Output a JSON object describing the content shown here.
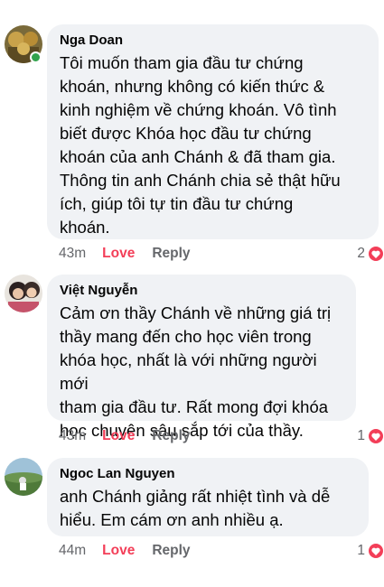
{
  "comments": [
    {
      "author": "Nga Doan",
      "online": true,
      "text": "Tôi muốn tham gia đầu tư chứng\nkhoán, nhưng không có kiến thức &\nkinh nghiệm về chứng khoán. Vô tình\nbiết được Khóa học đầu tư chứng\nkhoán của anh Chánh & đã tham gia.\nThông tin anh Chánh chia sẻ thật hữu\ních, giúp tôi tự tin đầu tư chứng\nkhoán.",
      "time": "43m",
      "love_label": "Love",
      "reply_label": "Reply",
      "reaction_count": "2",
      "reaction_icon": "heart-icon"
    },
    {
      "author": "Việt Nguyễn",
      "online": false,
      "text": "Cảm ơn thầy Chánh về những giá trị\nthầy mang đến cho học viên trong\nkhóa học, nhất là với những người mới\ntham gia đầu tư. Rất mong đợi khóa\nhọc chuyên sâu sắp tới của thầy.",
      "time": "43m",
      "love_label": "Love",
      "reply_label": "Reply",
      "reaction_count": "1",
      "reaction_icon": "heart-icon"
    },
    {
      "author": "Ngoc Lan Nguyen",
      "online": false,
      "text": "anh Chánh giảng rất nhiệt tình và dễ\nhiểu. Em cám ơn anh nhiều ạ.",
      "time": "44m",
      "love_label": "Love",
      "reply_label": "Reply",
      "reaction_count": "1",
      "reaction_icon": "heart-icon"
    }
  ],
  "colors": {
    "bubble": "#f0f2f5",
    "love": "#f33e58",
    "meta": "#65676b",
    "online": "#31a24c"
  }
}
